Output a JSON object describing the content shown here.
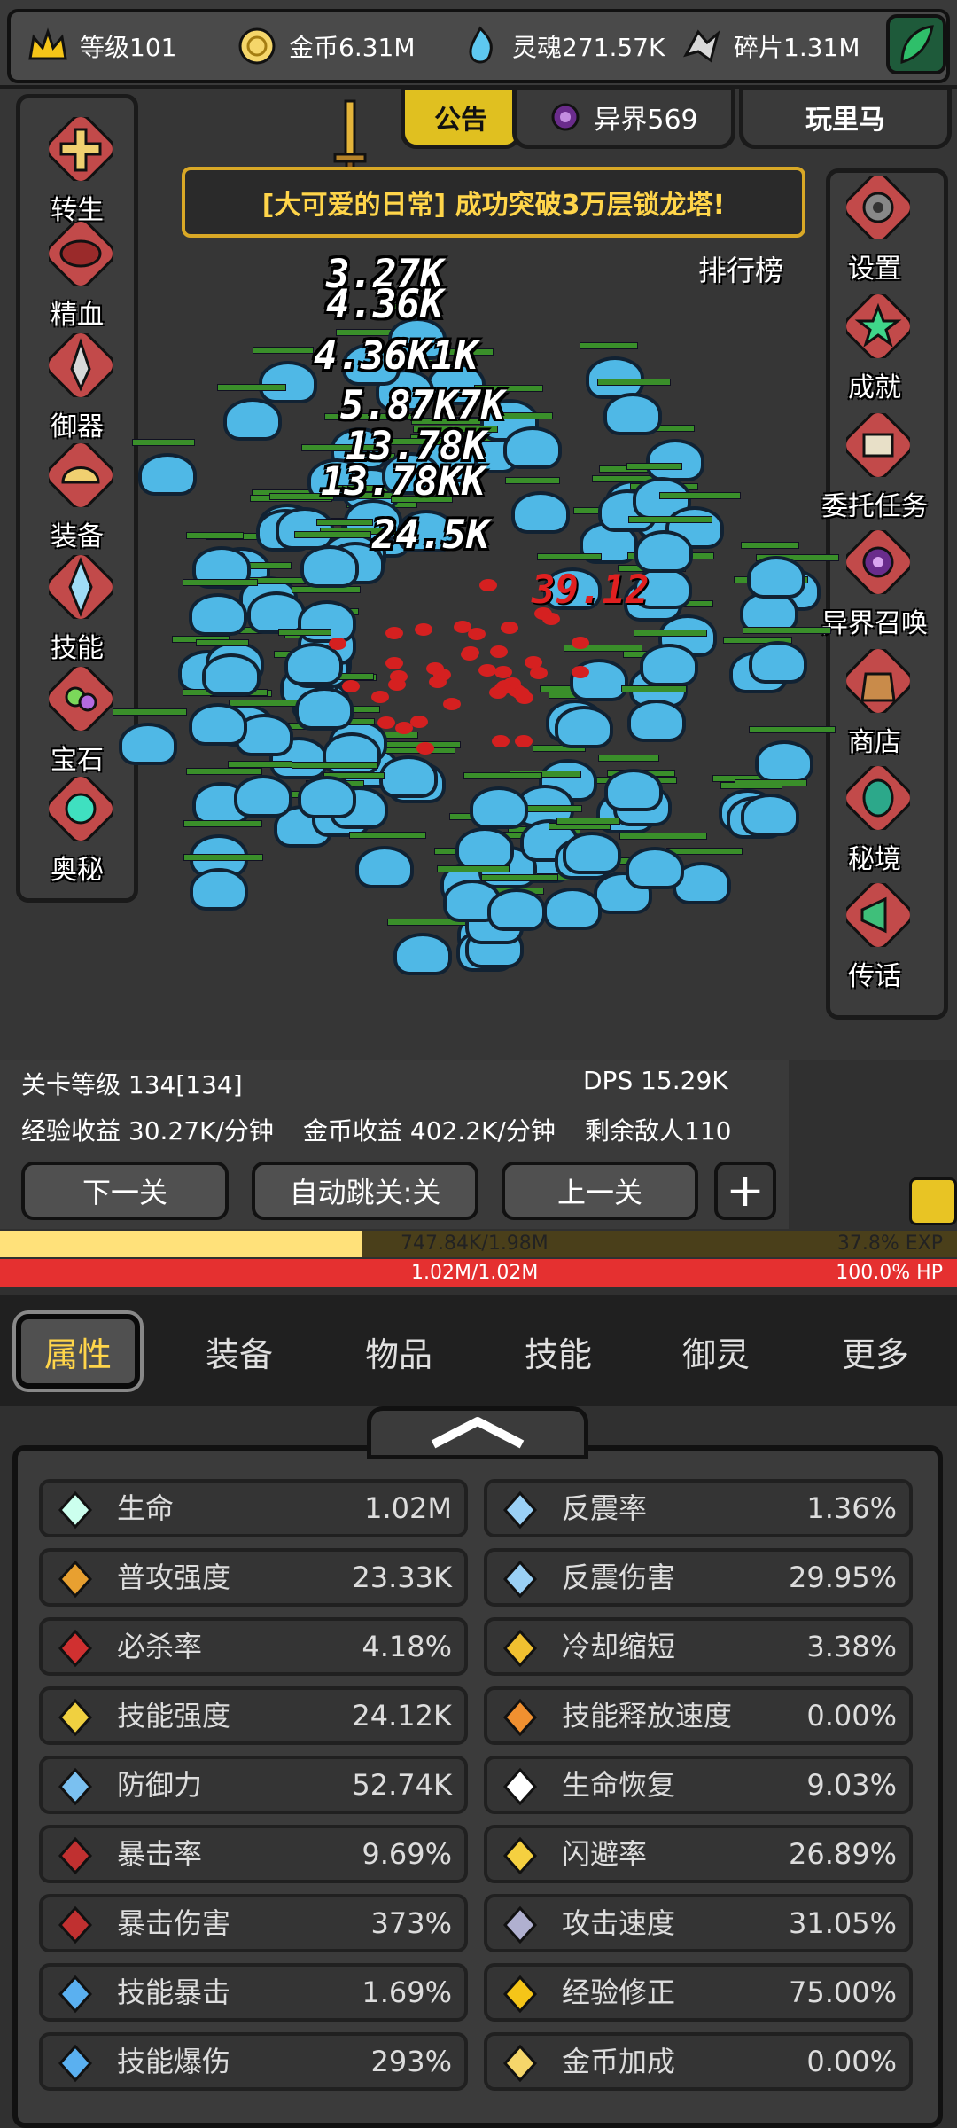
{
  "top_resources": [
    {
      "icon": "crown-icon",
      "label": "等级101"
    },
    {
      "icon": "gold-coin-icon",
      "label": "金币6.31M"
    },
    {
      "icon": "soul-icon",
      "label": "灵魂271.57K"
    },
    {
      "icon": "fragment-icon",
      "label": "碎片1.31M"
    }
  ],
  "top_tabs": {
    "notice": "公告",
    "otherworld": "异界569",
    "player": "玩里马"
  },
  "banner": "[大可爱的日常] 成功突破3万层锁龙塔!",
  "rank_label": "排行榜",
  "left_menu": [
    "转生",
    "精血",
    "御器",
    "装备",
    "技能",
    "宝石",
    "奥秘"
  ],
  "right_menu": [
    "设置",
    "成就",
    "委托任务",
    "异界召唤",
    "商店",
    "秘境",
    "传话"
  ],
  "damage_numbers": [
    "3.27K",
    "4.36K",
    "4.36K1K",
    "5.87K7K",
    "13.78K",
    "13.78KK",
    "24.5K"
  ],
  "red_hit": "39.12",
  "stage": {
    "level": "关卡等级 134[134]",
    "dps": "DPS 15.29K",
    "exp_rate": "经验收益 30.27K/分钟",
    "gold_rate": "金币收益 402.2K/分钟",
    "enemies": "剩余敌人110"
  },
  "nav_buttons": {
    "next": "下一关",
    "auto": "自动跳关:关",
    "prev": "上一关",
    "plus": "+"
  },
  "exp": {
    "text": "747.84K/1.98M",
    "percent": "37.8% EXP",
    "fraction": 0.378
  },
  "hp": {
    "text": "1.02M/1.02M",
    "percent": "100.0%  HP",
    "fraction": 1.0
  },
  "bottom_tabs": [
    "属性",
    "装备",
    "物品",
    "技能",
    "御灵",
    "更多"
  ],
  "stats_left": [
    {
      "name": "生命",
      "value": "1.02M",
      "icon": "life-icon"
    },
    {
      "name": "普攻强度",
      "value": "23.33K",
      "icon": "attack-icon"
    },
    {
      "name": "必杀率",
      "value": "4.18%",
      "icon": "lethal-icon"
    },
    {
      "name": "技能强度",
      "value": "24.12K",
      "icon": "skill-power-icon"
    },
    {
      "name": "防御力",
      "value": "52.74K",
      "icon": "shield-icon"
    },
    {
      "name": "暴击率",
      "value": "9.69%",
      "icon": "crit-rate-icon"
    },
    {
      "name": "暴击伤害",
      "value": "373%",
      "icon": "crit-damage-icon"
    },
    {
      "name": "技能暴击",
      "value": "1.69%",
      "icon": "skill-crit-icon"
    },
    {
      "name": "技能爆伤",
      "value": "293%",
      "icon": "skill-crit-damage-icon"
    }
  ],
  "stats_right": [
    {
      "name": "反震率",
      "value": "1.36%",
      "icon": "reflect-rate-icon"
    },
    {
      "name": "反震伤害",
      "value": "29.95%",
      "icon": "reflect-damage-icon"
    },
    {
      "name": "冷却缩短",
      "value": "3.38%",
      "icon": "cooldown-icon"
    },
    {
      "name": "技能释放速度",
      "value": "0.00%",
      "icon": "cast-speed-icon"
    },
    {
      "name": "生命恢复",
      "value": "9.03%",
      "icon": "regen-icon"
    },
    {
      "name": "闪避率",
      "value": "26.89%",
      "icon": "dodge-icon"
    },
    {
      "name": "攻击速度",
      "value": "31.05%",
      "icon": "attack-speed-icon"
    },
    {
      "name": "经验修正",
      "value": "75.00%",
      "icon": "exp-crown-icon"
    },
    {
      "name": "金币加成",
      "value": "0.00%",
      "icon": "gold-bonus-icon"
    }
  ],
  "colors": {
    "gold": "#ffd54a",
    "exp": "#ffe17a",
    "hp": "#e53030",
    "slime": "#4fb8e6"
  }
}
